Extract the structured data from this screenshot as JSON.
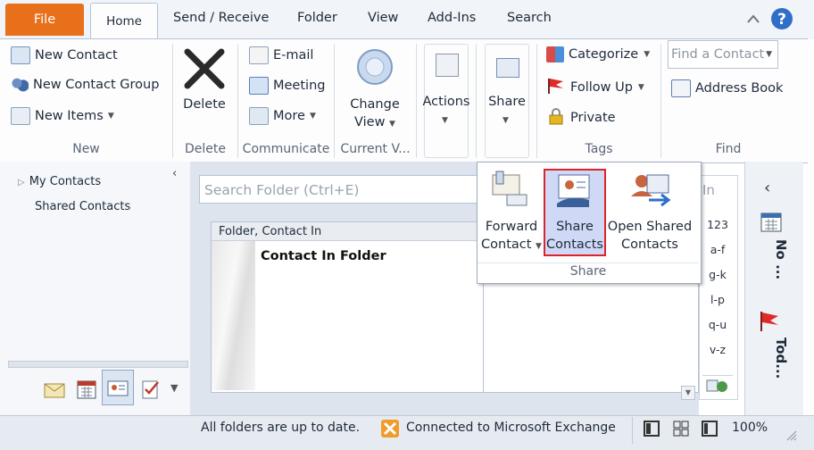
{
  "tabs": [
    "File",
    "Home",
    "Send / Receive",
    "Folder",
    "View",
    "Add-Ins",
    "Search"
  ],
  "ribbon": {
    "new_group": {
      "label": "New",
      "items": [
        "New Contact",
        "New Contact Group",
        "New Items"
      ]
    },
    "delete_group": {
      "label": "Delete",
      "button": "Delete"
    },
    "communicate_group": {
      "label": "Communicate",
      "items": [
        "E-mail",
        "Meeting",
        "More"
      ]
    },
    "current_view_group": {
      "label": "Current V...",
      "button_line1": "Change",
      "button_line2": "View"
    },
    "actions_button": "Actions",
    "share_button": "Share",
    "tags_group": {
      "label": "Tags",
      "items": [
        "Categorize",
        "Follow Up",
        "Private"
      ]
    },
    "find_group": {
      "label": "Find",
      "find_placeholder": "Find a Contact",
      "address_book": "Address Book"
    }
  },
  "nav": {
    "items": [
      "My Contacts",
      "Shared Contacts"
    ]
  },
  "search_placeholder": "Search Folder (Ctrl+E)",
  "list": {
    "header": "Folder, Contact In",
    "row_label": "Contact In Folder"
  },
  "alpha_index": [
    "123",
    "a-f",
    "g-k",
    "l-p",
    "q-u",
    "v-z"
  ],
  "alpha_partial": "In",
  "todo_bar": {
    "calendar_label": "No ...",
    "tasks_label": "Tod..."
  },
  "popup": {
    "label": "Share",
    "forward_contact_line1": "Forward",
    "forward_contact_line2": "Contact",
    "share_contacts_line1": "Share",
    "share_contacts_line2": "Contacts",
    "open_shared_line1": "Open Shared",
    "open_shared_line2": "Contacts"
  },
  "status": {
    "sync_text": "All folders are up to date.",
    "exchange_text": "Connected to Microsoft Exchange",
    "zoom": "100%"
  },
  "colors": {
    "file_tab": "#e8701a",
    "accent_blue": "#2f6fc9",
    "highlight_border": "#e0222a",
    "highlight_fill": "#cfd8f5"
  }
}
